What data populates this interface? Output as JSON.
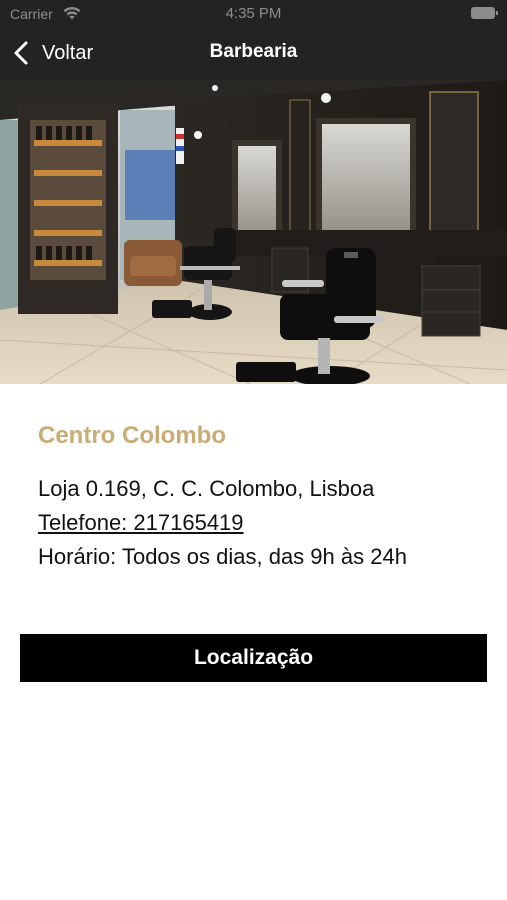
{
  "status_bar": {
    "carrier": "Carrier",
    "time": "4:35 PM"
  },
  "nav": {
    "back_label": "Voltar",
    "title": "Barbearia"
  },
  "hero": {
    "alt": "Interior da barbearia Centro Colombo"
  },
  "shop": {
    "name": "Centro Colombo",
    "address": "Loja 0.169, C. C. Colombo, Lisboa",
    "phone": "Telefone: 217165419",
    "hours": "Horário: Todos os dias, das 9h às 24h"
  },
  "actions": {
    "location_label": "Localização"
  },
  "colors": {
    "header_bg": "#232323",
    "accent_gold": "#c9ac74",
    "button_bg": "#000000"
  }
}
